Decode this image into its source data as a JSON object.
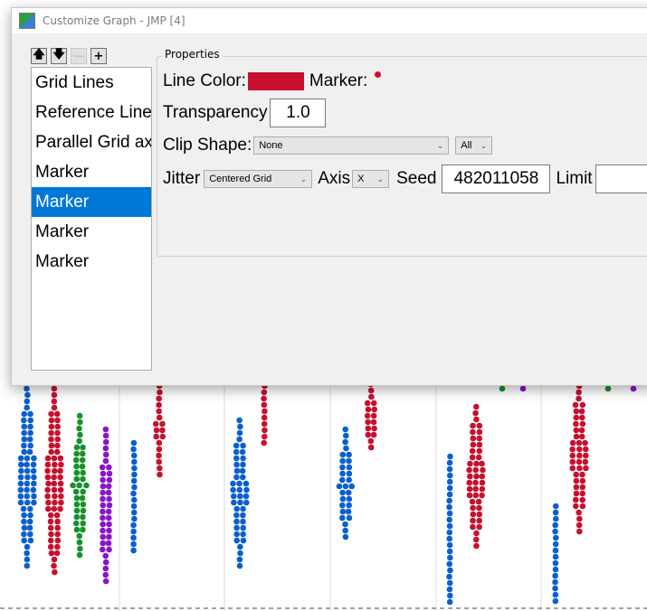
{
  "window": {
    "title": "Customize Graph - JMP [4]"
  },
  "toolbar": {
    "up": "🡅",
    "down": "🡇",
    "remove": "—",
    "add": "+"
  },
  "list": {
    "items": [
      "Grid Lines",
      "Reference Lines",
      "Parallel Grid axes",
      "Marker",
      "Marker",
      "Marker",
      "Marker"
    ],
    "selected_index": 4
  },
  "properties": {
    "group_label": "Properties",
    "line_color_label": "Line Color:",
    "line_color": "#c8102e",
    "marker_label": "Marker:",
    "transparency_label": "Transparency",
    "transparency_value": "1.0",
    "clip_shape_label": "Clip Shape:",
    "clip_shape_value": "None",
    "clip_scope_value": "All",
    "jitter_label": "Jitter",
    "jitter_value": "Centered Grid",
    "axis_label": "Axis",
    "axis_value": "X",
    "seed_label": "Seed",
    "seed_value": "482011058",
    "limit_label": "Limit",
    "limit_value": ""
  },
  "colors": {
    "blue": "#0a5fd0",
    "red": "#c8102e",
    "green": "#16922a",
    "purple": "#8a14c8"
  }
}
